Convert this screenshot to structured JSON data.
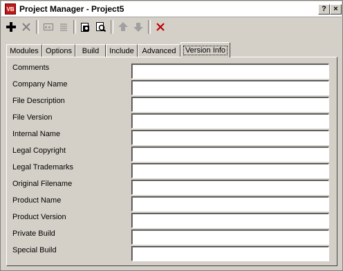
{
  "window": {
    "title": "Project Manager - Project5",
    "app_icon": "VB",
    "help_button": "?",
    "close_button": "×"
  },
  "toolbar": {
    "tools": [
      {
        "name": "add-icon"
      },
      {
        "name": "remove-icon"
      },
      {
        "name": "properties-icon"
      },
      {
        "name": "list-icon"
      },
      {
        "name": "open-icon"
      },
      {
        "name": "find-icon"
      },
      {
        "name": "move-up-icon"
      },
      {
        "name": "move-down-icon"
      },
      {
        "name": "delete-icon"
      }
    ]
  },
  "tabs": [
    {
      "label": "Modules"
    },
    {
      "label": "Options"
    },
    {
      "label": "Build"
    },
    {
      "label": "Include"
    },
    {
      "label": "Advanced"
    },
    {
      "label": "Version Info",
      "active": true
    }
  ],
  "fields": [
    {
      "label": "Comments",
      "value": ""
    },
    {
      "label": "Company Name",
      "value": ""
    },
    {
      "label": "File Description",
      "value": ""
    },
    {
      "label": "File Version",
      "value": ""
    },
    {
      "label": "Internal Name",
      "value": ""
    },
    {
      "label": "Legal Copyright",
      "value": ""
    },
    {
      "label": "Legal Trademarks",
      "value": ""
    },
    {
      "label": "Original Filename",
      "value": ""
    },
    {
      "label": "Product Name",
      "value": ""
    },
    {
      "label": "Product Version",
      "value": ""
    },
    {
      "label": "Private Build",
      "value": ""
    },
    {
      "label": "Special Build",
      "value": ""
    }
  ]
}
